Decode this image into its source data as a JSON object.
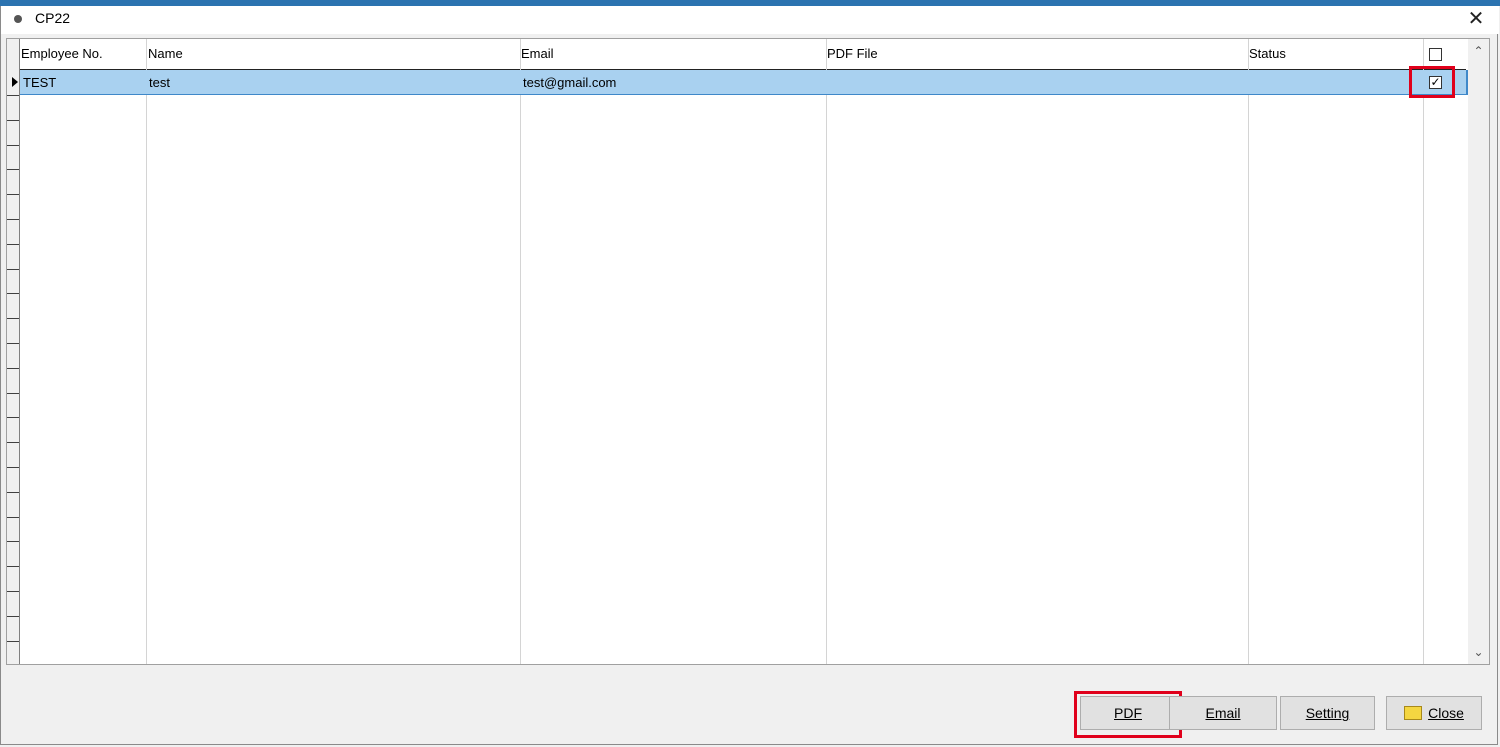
{
  "window": {
    "title": "CP22",
    "close_glyph": "✕"
  },
  "grid": {
    "columns": [
      "Employee No.",
      "Name",
      "Email",
      "PDF File",
      "Status"
    ],
    "header_checkbox_checked": false,
    "rows": [
      {
        "employee_no": "TEST",
        "name": "test",
        "email": "test@gmail.com",
        "pdf_file": "",
        "status": "",
        "checked": true
      }
    ],
    "selected_row": 0
  },
  "buttons": {
    "pdf": "PDF",
    "email": "Email",
    "setting": "Setting",
    "close": "Close"
  },
  "colors": {
    "selection": "#a9d1f0",
    "highlight_box": "#e0001b",
    "title_accent": "#2b73b0"
  }
}
